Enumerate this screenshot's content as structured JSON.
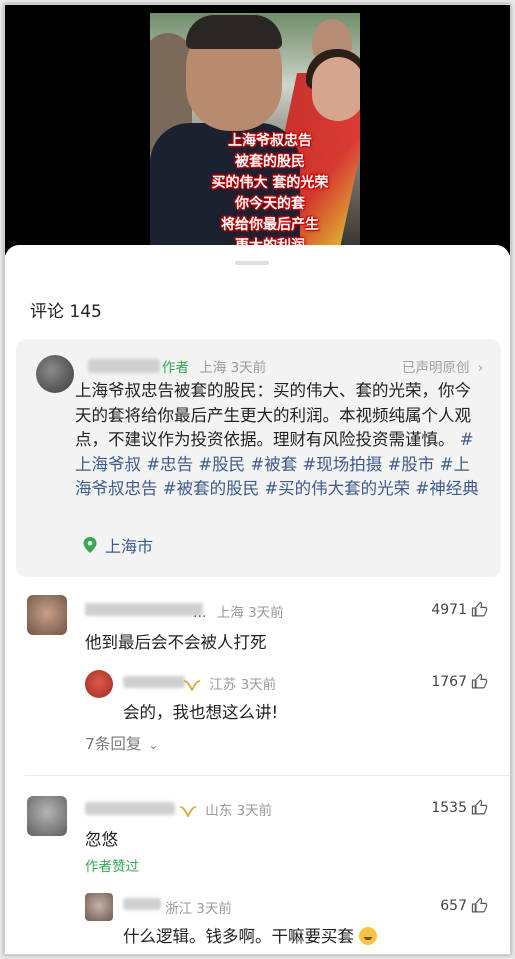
{
  "video": {
    "caption_lines": [
      "上海爷叔忠告",
      "被套的股民",
      "买的伟大 套的光荣",
      "你今天的套",
      "将给你最后产生",
      "更大的利润"
    ]
  },
  "comments_panel": {
    "title": "评论 145",
    "author_post": {
      "author_tag": "作者",
      "location_time": "上海  3天前",
      "declaration": "已声明原创",
      "text_plain": "上海爷叔忠告被套的股民：买的伟大、套的光荣，你今天的套将给你最后产生更大的利润。本视频纯属个人观点，不建议作为投资依据。理财有风险投资需谨慎。",
      "hashtags": [
        "#上海爷叔",
        "#忠告",
        "#股民",
        "#被套",
        "#现场拍摄",
        "#股市",
        "#上海爷叔忠告",
        "#被套的股民",
        "#买的伟大套的光荣",
        "#神经典"
      ],
      "location": "上海市"
    },
    "comments": [
      {
        "username_suffix": "…",
        "location_time": "上海  3天前",
        "text": "他到最后会不会被人打死",
        "likes": "4971",
        "reply": {
          "location_time": "江苏  3天前",
          "text": "会的，我也想这么讲!",
          "likes": "1767"
        },
        "more_replies": "7条回复"
      },
      {
        "location_time": "山东  3天前",
        "text": "忽悠",
        "likes": "1535",
        "liked_by_author": "作者赞过",
        "reply": {
          "location_time": "浙江  3天前",
          "text": "什么逻辑。钱多啊。干嘛要买套",
          "likes": "657"
        }
      }
    ]
  },
  "colors": {
    "accent_green": "#34a853",
    "link_blue": "#3d5b8c",
    "caption_red": "#cc0000"
  },
  "icons": [
    "location-pin-icon",
    "chevron-right-icon",
    "thumbs-up-icon",
    "chevron-down-icon",
    "vip-badge-icon",
    "sweat-smile-emoji-icon"
  ]
}
